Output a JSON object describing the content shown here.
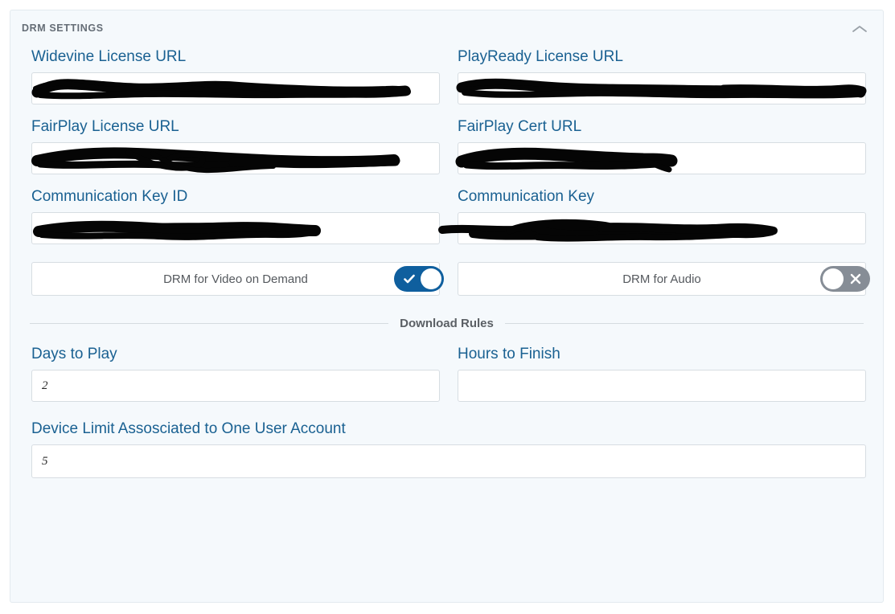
{
  "panel": {
    "title": "DRM SETTINGS",
    "collapse_icon": "chevron-up-icon"
  },
  "fields": [
    {
      "label": "Widevine License URL",
      "value": "",
      "redacted": true
    },
    {
      "label": "PlayReady License URL",
      "value": "",
      "redacted": true
    },
    {
      "label": "FairPlay License URL",
      "value": "",
      "redacted": true
    },
    {
      "label": "FairPlay Cert URL",
      "value": "",
      "redacted": true
    },
    {
      "label": "Communication Key ID",
      "value": "",
      "redacted": true
    },
    {
      "label": "Communication Key",
      "value": "",
      "redacted": true
    }
  ],
  "toggles": [
    {
      "label": "DRM for Video on Demand",
      "state": "on",
      "icon": "check-icon"
    },
    {
      "label": "DRM for Audio",
      "state": "off",
      "icon": "close-icon"
    }
  ],
  "download_rules": {
    "section_label": "Download Rules",
    "days_to_play": {
      "label": "Days to Play",
      "value": "2",
      "placeholder": ""
    },
    "hours_to_finish": {
      "label": "Hours to Finish",
      "value": "",
      "placeholder": ""
    },
    "device_limit": {
      "label": "Device Limit Assosciated to One User Account",
      "value": "5",
      "placeholder": ""
    }
  },
  "colors": {
    "panel_background": "#f5f9fc",
    "panel_border": "#e3eaef",
    "label_blue": "#1a6192",
    "header_gray": "#656d76",
    "input_border": "#d7dde2",
    "toggle_on": "#0f5f9e",
    "toggle_off": "#868d96",
    "redaction": "#000000"
  }
}
